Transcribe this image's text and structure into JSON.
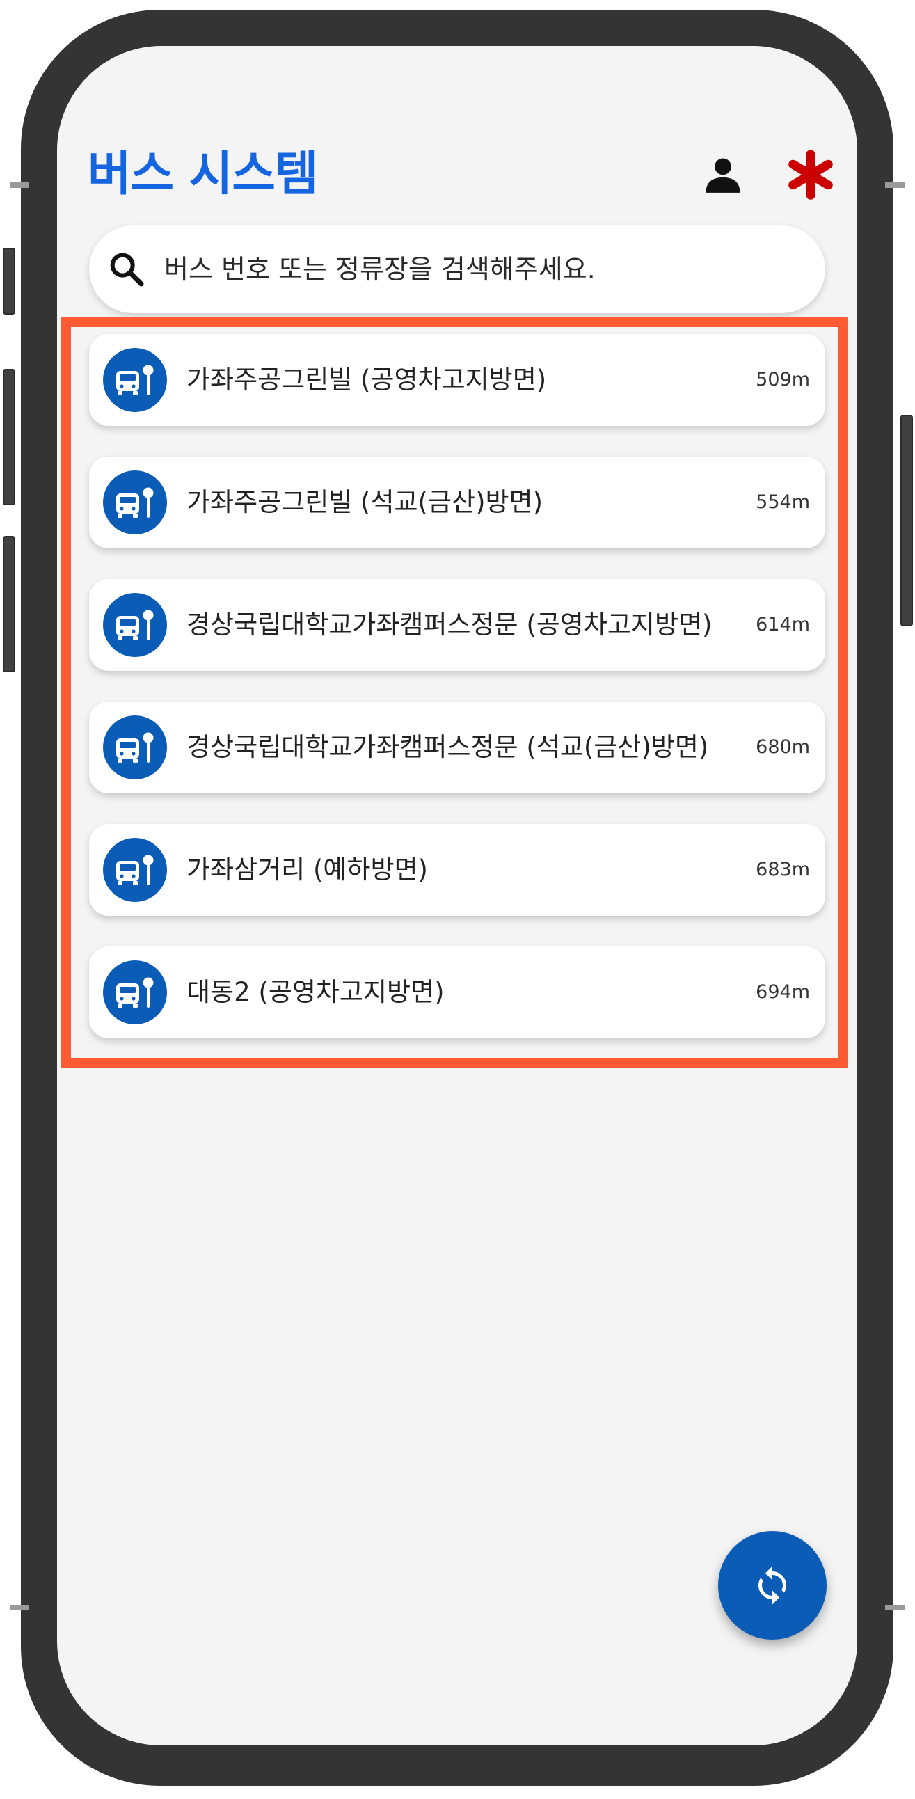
{
  "app": {
    "title": "버스 시스템",
    "accent_color": "#1565e0",
    "highlight_color": "#ff5b33",
    "asterisk_color": "#cc0000"
  },
  "header": {
    "user_icon": "person-icon",
    "menu_icon": "asterisk-icon"
  },
  "search": {
    "icon": "search-icon",
    "placeholder": "버스 번호 또는 정류장을 검색해주세요.",
    "value": ""
  },
  "stops": [
    {
      "name": "가좌주공그린빌 (공영차고지방면)",
      "distance": "509m"
    },
    {
      "name": "가좌주공그린빌 (석교(금산)방면)",
      "distance": "554m"
    },
    {
      "name": "경상국립대학교가좌캠퍼스정문 (공영차고지방면)",
      "distance": "614m"
    },
    {
      "name": "경상국립대학교가좌캠퍼스정문 (석교(금산)방면)",
      "distance": "680m"
    },
    {
      "name": "가좌삼거리 (예하방면)",
      "distance": "683m"
    },
    {
      "name": "대동2 (공영차고지방면)",
      "distance": "694m"
    }
  ],
  "stop_icon": "bus-stop-icon",
  "fab": {
    "icon": "refresh-icon"
  }
}
